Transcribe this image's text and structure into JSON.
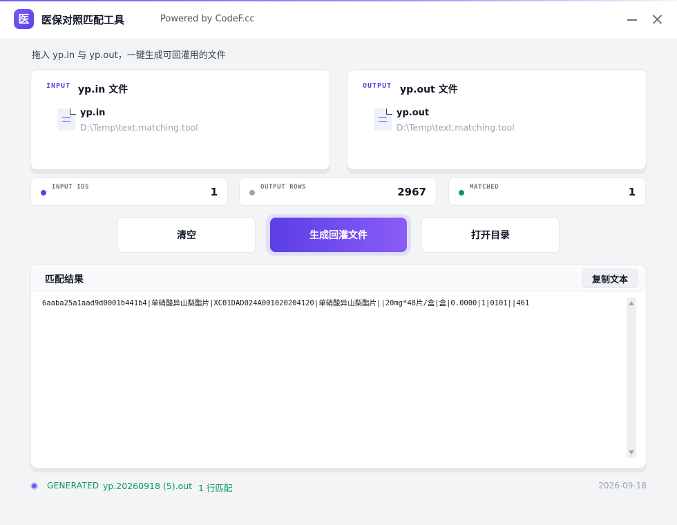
{
  "titlebar": {
    "logo_char": "医",
    "title": "医保对照匹配工具",
    "powered": "Powered by CodeF.cc"
  },
  "hint": "拖入 yp.in 与 yp.out，一键生成可回灌用的文件",
  "input_card": {
    "tag": "INPUT",
    "title": "yp.in 文件",
    "file_name": "yp.in",
    "file_path": "D:\\Temp\\text.matching.tool"
  },
  "output_card": {
    "tag": "OUTPUT",
    "title": "yp.out 文件",
    "file_name": "yp.out",
    "file_path": "D:\\Temp\\text.matching.tool"
  },
  "stats": [
    {
      "label": "INPUT IDS",
      "value": "1",
      "color": "#4f46e5"
    },
    {
      "label": "OUTPUT ROWS",
      "value": "2967",
      "color": "#9ca3af"
    },
    {
      "label": "MATCHED",
      "value": "1",
      "color": "#059669"
    }
  ],
  "actions": {
    "clear": "清空",
    "generate": "生成回灌文件",
    "open_dir": "打开目录"
  },
  "result": {
    "title": "匹配结果",
    "copy": "复制文本",
    "text": "6aaba25a1aad9d0001b441b4|单硝酸异山梨酯片|XC01DAD024A001020204120|单硝酸异山梨酯片||20mg*48片/盒|盒|0.0000|1|0101||461"
  },
  "status": {
    "label": "GENERATED",
    "file": "yp.20260918 (5).out",
    "separator": "·",
    "match": "1 行匹配",
    "date": "2026-09-18"
  }
}
